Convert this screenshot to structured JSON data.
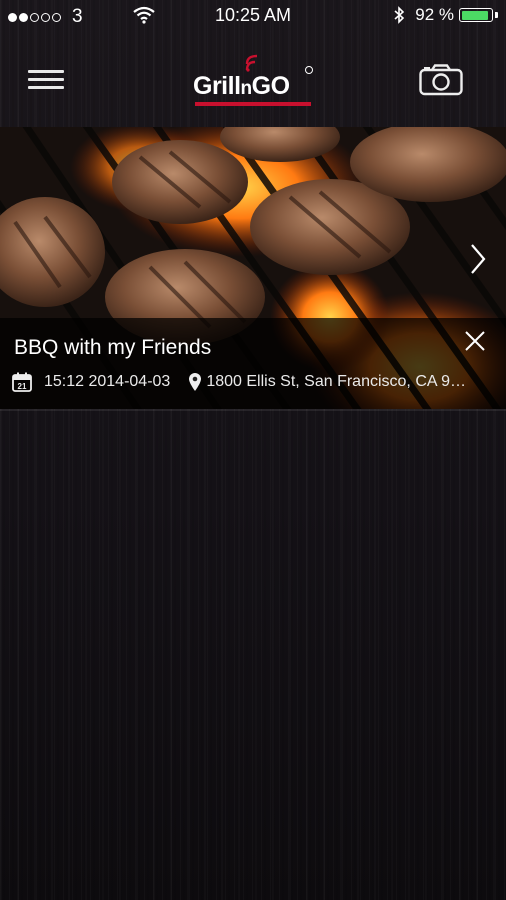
{
  "status_bar": {
    "signal_dots_filled": 2,
    "signal_dots_total": 5,
    "carrier": "3",
    "time": "10:25 AM",
    "battery_percent": "92 %",
    "battery_level": 0.92,
    "battery_color": "#4cd964",
    "icons": [
      "wifi-icon",
      "bluetooth-icon",
      "battery-icon"
    ]
  },
  "nav": {
    "logo": {
      "part1": "Grill",
      "part2": "n",
      "part3": "GO",
      "accent_color": "#c8102e"
    },
    "icons": [
      "hamburger-menu-icon",
      "camera-icon"
    ]
  },
  "event": {
    "title": "BBQ with my Friends",
    "datetime": "15:12 2014-04-03",
    "address": "1800 Ellis St, San Francisco, CA 9…",
    "calendar_day": "21",
    "icons": [
      "calendar-icon",
      "location-pin-icon",
      "close-icon",
      "chevron-right-icon"
    ]
  }
}
